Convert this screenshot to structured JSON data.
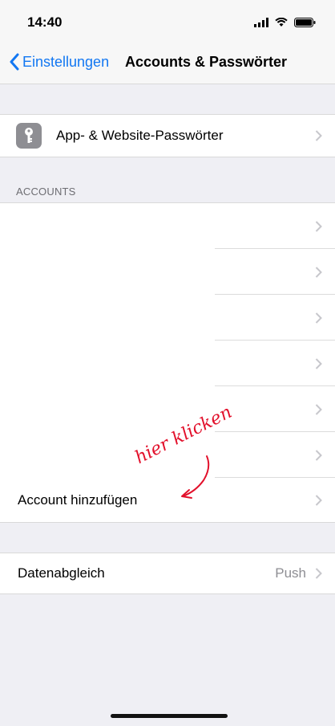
{
  "status": {
    "time": "14:40"
  },
  "nav": {
    "back_label": "Einstellungen",
    "title": "Accounts & Passwörter"
  },
  "passwords": {
    "label": "App- & Website-Passwörter"
  },
  "accounts": {
    "header": "ACCOUNTS",
    "add_label": "Account hinzufügen"
  },
  "fetch": {
    "label": "Datenabgleich",
    "value": "Push"
  },
  "annotation": {
    "text": "hier klicken"
  },
  "colors": {
    "accent": "#1277f2",
    "annotation": "#e2102b"
  }
}
